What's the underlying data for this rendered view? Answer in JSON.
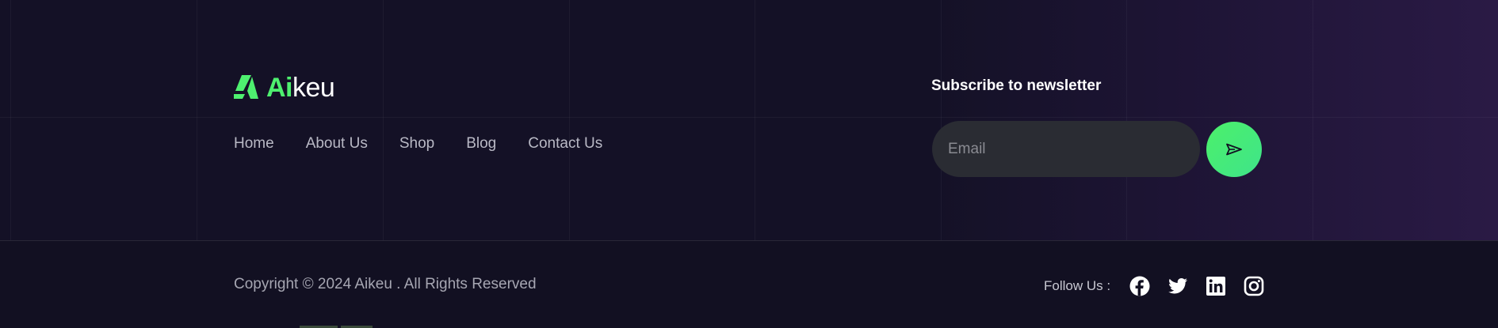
{
  "brand": {
    "name_highlight": "Ai",
    "name_rest": "keu",
    "accent_color": "#4ef06f"
  },
  "nav": {
    "items": [
      {
        "label": "Home"
      },
      {
        "label": "About Us"
      },
      {
        "label": "Shop"
      },
      {
        "label": "Blog"
      },
      {
        "label": "Contact Us"
      }
    ]
  },
  "newsletter": {
    "title": "Subscribe to newsletter",
    "email_placeholder": "Email",
    "email_value": "",
    "submit_icon": "send-icon"
  },
  "footer_bottom": {
    "copyright": "Copyright © 2024 Aikeu . All Rights Reserved",
    "follow_label": "Follow Us :",
    "social": [
      {
        "icon": "facebook-icon"
      },
      {
        "icon": "twitter-icon"
      },
      {
        "icon": "linkedin-icon"
      },
      {
        "icon": "instagram-icon"
      }
    ]
  },
  "colors": {
    "background": "#121022",
    "gradient_end": "#2a1a45",
    "input_bg": "#2a2c33",
    "button_green": "#4cf06a"
  }
}
